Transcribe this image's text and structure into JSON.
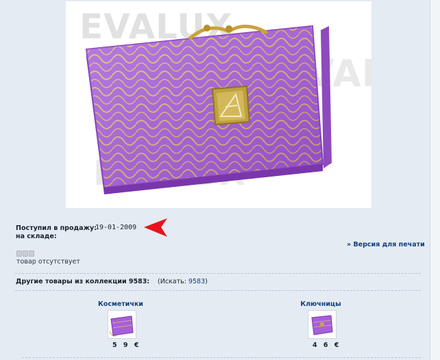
{
  "product": {
    "image_alt": "Purple wallet",
    "watermark": "EVALUX"
  },
  "info": {
    "arrival_label": "Поступил в продажу:",
    "arrival_date": "19-01-2009",
    "stock_label": "на складе:"
  },
  "print_link": "» Версия для печати",
  "availability": {
    "status": "товар отсутствует",
    "dots_count": 3
  },
  "collection": {
    "label": "Другие товары из коллекции 9583:",
    "search_prefix": "(Искать:",
    "search_link": "9583",
    "search_suffix": ")"
  },
  "related_items": [
    {
      "title": "Косметички",
      "price": "5 9 €"
    },
    {
      "title": "Ключницы",
      "price": "4 6 €"
    }
  ],
  "colors": {
    "background": "#e4ebf2",
    "link": "#123f7a",
    "arrow": "#e8131d",
    "product": "#a65bd8"
  }
}
